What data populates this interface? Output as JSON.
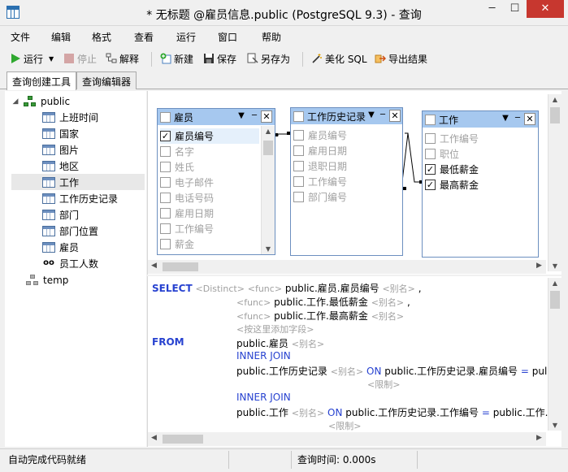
{
  "window": {
    "title": "* 无标题 @雇员信息.public (PostgreSQL 9.3) - 查询",
    "minimize": "─",
    "maximize": "☐",
    "close": "✕"
  },
  "menu": [
    "文件",
    "编辑",
    "格式",
    "查看",
    "运行",
    "窗口",
    "帮助"
  ],
  "toolbar": {
    "run": "运行",
    "stop": "停止",
    "explain": "解释",
    "new": "新建",
    "save": "保存",
    "save_as": "另存为",
    "beautify": "美化 SQL",
    "export": "导出结果"
  },
  "tabs": [
    "查询创建工具",
    "查询编辑器"
  ],
  "tree": {
    "schema": "public",
    "tables": [
      "上班时间",
      "国家",
      "图片",
      "地区",
      "工作",
      "工作历史记录",
      "部门",
      "部门位置",
      "雇员"
    ],
    "view": "员工人数",
    "other_schema": "temp",
    "selected": "工作"
  },
  "designer": {
    "boxes": [
      {
        "title": "雇员",
        "fields": [
          {
            "name": "雇员编号",
            "checked": true
          },
          {
            "name": "名字",
            "checked": false
          },
          {
            "name": "姓氏",
            "checked": false
          },
          {
            "name": "电子邮件",
            "checked": false
          },
          {
            "name": "电话号码",
            "checked": false
          },
          {
            "name": "雇用日期",
            "checked": false
          },
          {
            "name": "工作编号",
            "checked": false
          },
          {
            "name": "薪金",
            "checked": false
          }
        ]
      },
      {
        "title": "工作历史记录",
        "fields": [
          {
            "name": "雇员编号",
            "checked": false
          },
          {
            "name": "雇用日期",
            "checked": false
          },
          {
            "name": "退职日期",
            "checked": false
          },
          {
            "name": "工作编号",
            "checked": false
          },
          {
            "name": "部门编号",
            "checked": false
          }
        ]
      },
      {
        "title": "工作",
        "fields": [
          {
            "name": "工作编号",
            "checked": false
          },
          {
            "name": "职位",
            "checked": false
          },
          {
            "name": "最低薪金",
            "checked": true
          },
          {
            "name": "最高薪金",
            "checked": true
          }
        ]
      }
    ]
  },
  "sql": {
    "select_kw": "SELECT",
    "distinct": "<Distinct>",
    "func": "<func>",
    "alias": "<别名>",
    "col1": "public.雇员.雇员编号",
    "col2": "public.工作.最低薪金",
    "col3": "public.工作.最高薪金",
    "comma": ",",
    "add_field": "<按这里添加字段>",
    "from_kw": "FROM",
    "table1": "public.雇员",
    "join_kw": "INNER JOIN",
    "table2": "public.工作历史记录",
    "on_kw": "ON",
    "cond1_left": "public.工作历史记录.雇员编号",
    "eq": "=",
    "cond1_right": "pul",
    "limit": "<限制>",
    "table3": "public.工作",
    "cond2_left": "public.工作历史记录.工作编号",
    "cond2_right": "public.工作."
  },
  "status": {
    "left": "自动完成代码就绪",
    "right": "查询时间: 0.000s"
  }
}
